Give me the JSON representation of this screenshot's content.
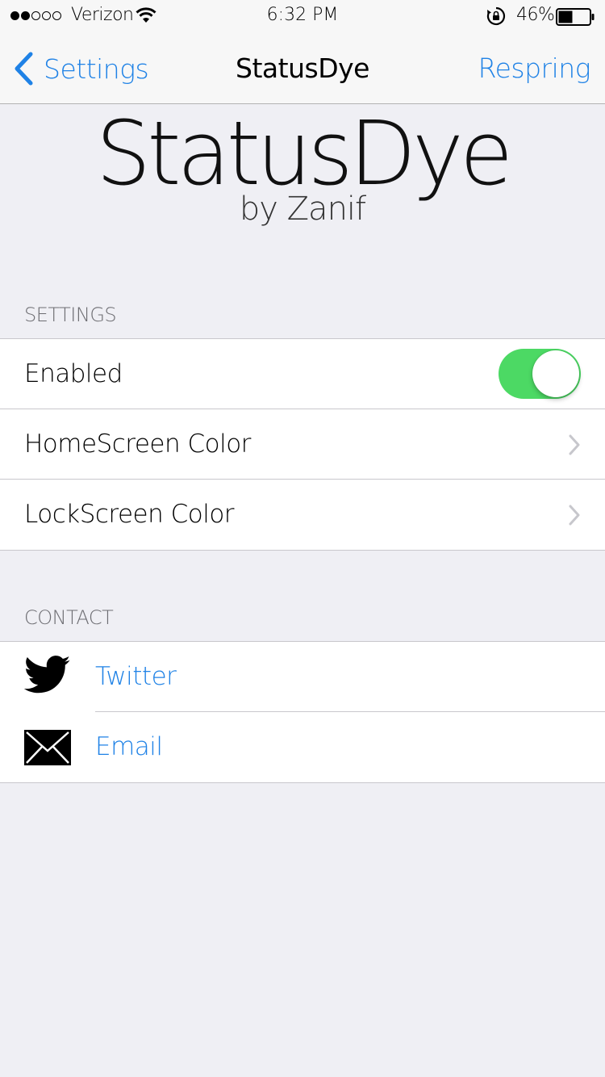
{
  "status_bar": {
    "carrier": "Verizon",
    "signal_filled": 2,
    "signal_total": 5,
    "time": "6:32 PM",
    "battery_percent": "46%",
    "battery_level": 0.46
  },
  "nav": {
    "back_label": "Settings",
    "title": "StatusDye",
    "right_label": "Respring",
    "accent_color": "#1f82e6"
  },
  "header": {
    "title": "StatusDye",
    "subtitle": "by Zanif"
  },
  "settings_section": {
    "header": "SETTINGS",
    "enabled_label": "Enabled",
    "enabled_on": true,
    "homescreen_label": "HomeScreen Color",
    "lockscreen_label": "LockScreen Color",
    "toggle_color": "#4cd964"
  },
  "contact_section": {
    "header": "CONTACT",
    "items": [
      {
        "label": "Twitter",
        "icon": "twitter-bird-icon"
      },
      {
        "label": "Email",
        "icon": "envelope-icon"
      }
    ]
  }
}
